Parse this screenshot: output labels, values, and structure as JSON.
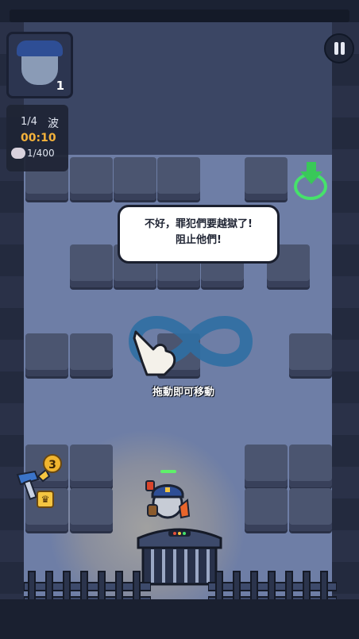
{
  "hud": {
    "hero_level": "1",
    "wave_current": "1/4",
    "wave_unit": "波",
    "timer": "00:10",
    "kill_count": "1/400"
  },
  "dialog": {
    "line1": "不好，罪犯們要越獄了!",
    "line2": "阻止他們!"
  },
  "tutorial": {
    "drag_hint": "拖動即可移動",
    "gesture_icon": "infinity-swipe-icon"
  },
  "skill": {
    "badge_count": "3",
    "icon": "hammer-icon",
    "crown": "♛"
  },
  "colors": {
    "floor": "#6e7ea6",
    "block": "#4b5570",
    "exit_green": "#46e26b",
    "timer": "#f4b23b",
    "badge": "#f1b52f",
    "infinity": "#2f6fa3"
  }
}
